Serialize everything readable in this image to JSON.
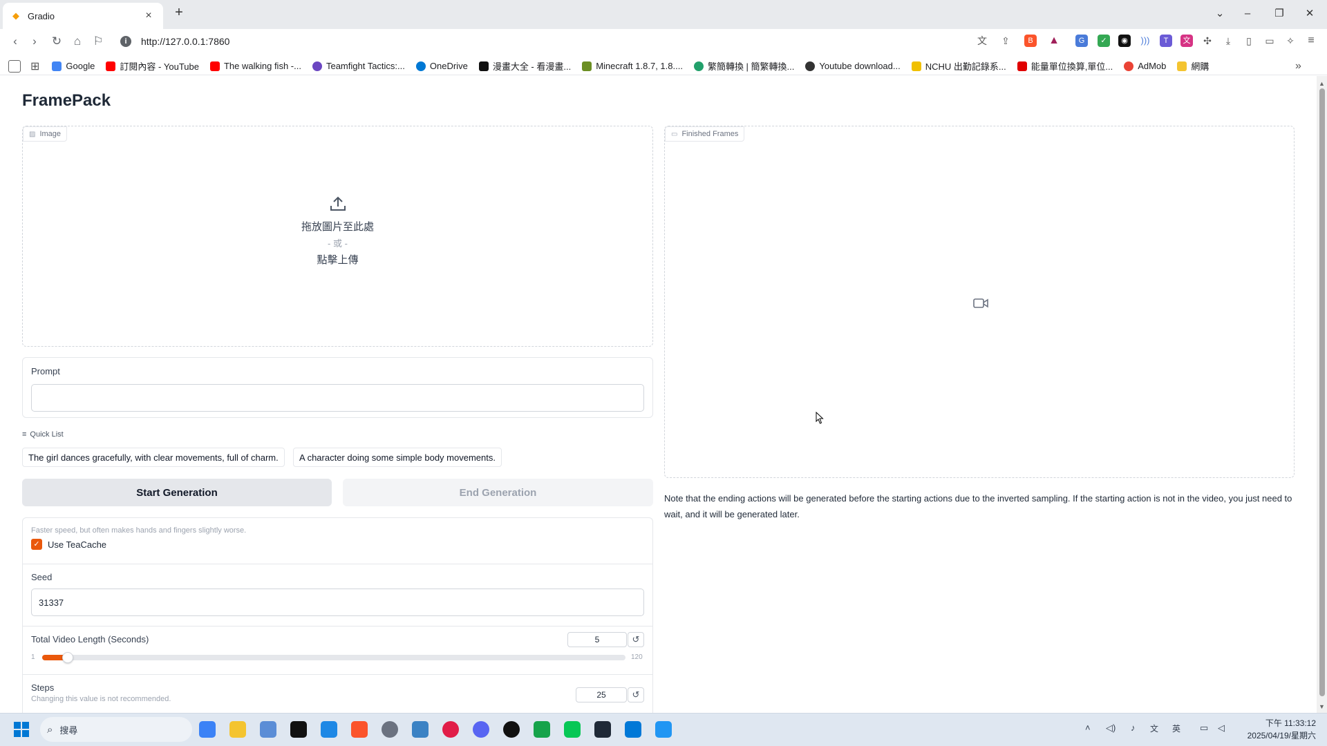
{
  "browser": {
    "tab_title": "Gradio",
    "address": "http://127.0.0.1:7860",
    "bookmarks": [
      {
        "label": "Google",
        "color": "#4285f4"
      },
      {
        "label": "訂閱內容 - YouTube",
        "color": "#ff0000"
      },
      {
        "label": "The walking fish -...",
        "color": "#ff0000"
      },
      {
        "label": "Teamfight Tactics:...",
        "color": "#6b46c1"
      },
      {
        "label": "OneDrive",
        "color": "#0078d4"
      },
      {
        "label": "漫畫大全 - 看漫畫...",
        "color": "#111111"
      },
      {
        "label": "Minecraft 1.8.7, 1.8....",
        "color": "#6b8e23"
      },
      {
        "label": "繁簡轉換 | 簡繁轉換...",
        "color": "#22a06b"
      },
      {
        "label": "Youtube download...",
        "color": "#333333"
      },
      {
        "label": "NCHU 出勤記錄系...",
        "color": "#f0c000"
      },
      {
        "label": "能量單位換算,單位...",
        "color": "#e00000"
      },
      {
        "label": "AdMob",
        "color": "#ea4335"
      },
      {
        "label": "網購",
        "color": "#f4c430"
      }
    ]
  },
  "app": {
    "title": "FramePack",
    "image_block_label": "Image",
    "upload_drop_text": "拖放圖片至此處",
    "upload_or_text": "- 或 -",
    "upload_click_text": "點擊上傳",
    "prompt_label": "Prompt",
    "prompt_value": "",
    "quick_list_label": "Quick List",
    "quick_list": [
      "The girl dances gracefully, with clear movements, full of charm.",
      "A character doing some simple body movements."
    ],
    "start_button": "Start Generation",
    "end_button": "End Generation",
    "teacache_hint": "Faster speed, but often makes hands and fingers slightly worse.",
    "teacache_label": "Use TeaCache",
    "teacache_checked": true,
    "seed_label": "Seed",
    "seed_value": "31337",
    "video_length_label": "Total Video Length (Seconds)",
    "video_length_value": "5",
    "video_length_min": "1",
    "video_length_max": "120",
    "video_length_fraction": 0.034,
    "steps_label": "Steps",
    "steps_hint": "Changing this value is not recommended.",
    "steps_value": "25",
    "finished_frames_label": "Finished Frames",
    "note": "Note that the ending actions will be generated before the starting actions due to the inverted sampling. If the starting action is not in the video, you just need to wait, and it will be generated later.",
    "accent_color": "#ea580c"
  },
  "taskbar": {
    "search_placeholder": "搜尋",
    "time": "下午 11:33:12",
    "date": "2025/04/19/星期六"
  }
}
